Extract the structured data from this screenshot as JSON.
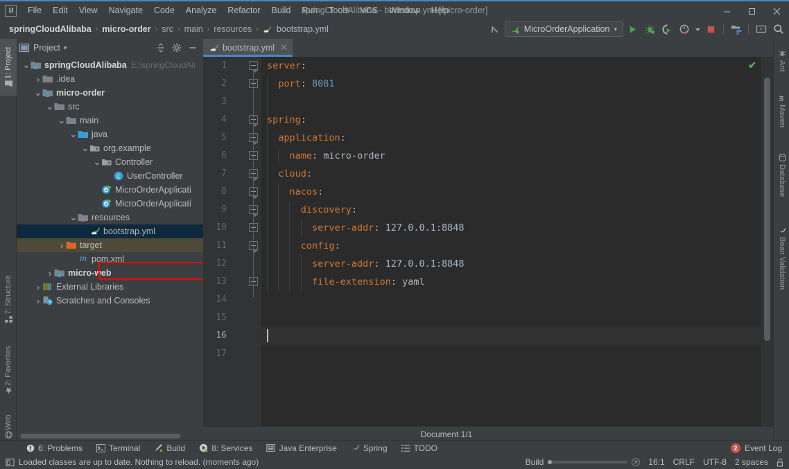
{
  "window": {
    "title": "springCloudAlibaba - bootstrap.yml [micro-order]",
    "minimize": "—",
    "maximize": "☐",
    "close": "✕"
  },
  "menu": {
    "items": [
      "File",
      "Edit",
      "View",
      "Navigate",
      "Code",
      "Analyze",
      "Refactor",
      "Build",
      "Run",
      "Tools",
      "VCS",
      "Window",
      "Help"
    ]
  },
  "breadcrumb": {
    "items": [
      {
        "label": "springCloudAlibaba",
        "style": "bold"
      },
      {
        "label": "micro-order",
        "style": "bold"
      },
      {
        "label": "src",
        "style": "dim"
      },
      {
        "label": "main",
        "style": "dim"
      },
      {
        "label": "resources",
        "style": "dim"
      },
      {
        "label": "bootstrap.yml",
        "style": "file"
      }
    ],
    "separator": "›"
  },
  "toolbar": {
    "run_config": "MicroOrderApplication",
    "dropdown_caret": "▾",
    "icons": [
      "back-arrow-icon",
      "run-icon",
      "debug-icon",
      "run-coverage-icon",
      "profiler-icon",
      "stop-icon",
      "project-structure-icon",
      "show-in-window-icon",
      "search-everywhere-icon"
    ]
  },
  "left_stripe": {
    "items": [
      {
        "label": "1: Project",
        "active": true
      },
      {
        "label": "7: Structure",
        "active": false
      },
      {
        "label": "2: Favorites",
        "active": false
      },
      {
        "label": "Web",
        "active": false
      }
    ]
  },
  "right_stripe": {
    "items": [
      {
        "label": "Ant"
      },
      {
        "label": "Maven"
      },
      {
        "label": "Database"
      },
      {
        "label": "Bean Validation"
      }
    ]
  },
  "project_panel": {
    "title": "Project",
    "caret": "▾",
    "header_icons": [
      "collapse-all-icon",
      "settings-gear-icon",
      "hide-icon"
    ],
    "tree": [
      {
        "indent": 0,
        "arrow": "⌄",
        "icon": "module-folder-icon",
        "label": "springCloudAlibaba",
        "bold": true,
        "path": "E:\\springCloudAli",
        "state": "normal"
      },
      {
        "indent": 1,
        "arrow": "›",
        "icon": "folder-icon",
        "label": ".idea",
        "bold": false,
        "path": "",
        "state": "normal"
      },
      {
        "indent": 1,
        "arrow": "⌄",
        "icon": "module-folder-icon",
        "label": "micro-order",
        "bold": true,
        "path": "",
        "state": "normal"
      },
      {
        "indent": 2,
        "arrow": "⌄",
        "icon": "folder-icon",
        "label": "src",
        "bold": false,
        "path": "",
        "state": "normal"
      },
      {
        "indent": 3,
        "arrow": "⌄",
        "icon": "folder-icon",
        "label": "main",
        "bold": false,
        "path": "",
        "state": "normal"
      },
      {
        "indent": 4,
        "arrow": "⌄",
        "icon": "source-folder-icon",
        "label": "java",
        "bold": false,
        "path": "",
        "state": "normal"
      },
      {
        "indent": 5,
        "arrow": "⌄",
        "icon": "package-icon",
        "label": "org.example",
        "bold": false,
        "path": "",
        "state": "normal"
      },
      {
        "indent": 6,
        "arrow": "⌄",
        "icon": "package-icon",
        "label": "Controller",
        "bold": false,
        "path": "",
        "state": "normal"
      },
      {
        "indent": 7,
        "arrow": "",
        "icon": "java-class-icon",
        "label": "UserController",
        "bold": false,
        "path": "",
        "state": "normal"
      },
      {
        "indent": 6,
        "arrow": "",
        "icon": "spring-class-icon",
        "label": "MicroOrderApplicati",
        "bold": false,
        "path": "",
        "state": "normal"
      },
      {
        "indent": 6,
        "arrow": "",
        "icon": "spring-class-icon",
        "label": "MicroOrderApplicati",
        "bold": false,
        "path": "",
        "state": "normal"
      },
      {
        "indent": 4,
        "arrow": "⌄",
        "icon": "resource-folder-icon",
        "label": "resources",
        "bold": false,
        "path": "",
        "state": "normal"
      },
      {
        "indent": 5,
        "arrow": "",
        "icon": "yaml-leaf-icon",
        "label": "bootstrap.yml",
        "bold": false,
        "path": "",
        "state": "selected"
      },
      {
        "indent": 3,
        "arrow": "›",
        "icon": "target-folder-icon",
        "label": "target",
        "bold": false,
        "path": "",
        "state": "target"
      },
      {
        "indent": 4,
        "arrow": "",
        "icon": "maven-icon",
        "label": "pom.xml",
        "bold": false,
        "path": "",
        "state": "normal"
      },
      {
        "indent": 2,
        "arrow": "›",
        "icon": "module-folder-icon",
        "label": "micro-web",
        "bold": true,
        "path": "",
        "state": "normal"
      },
      {
        "indent": 1,
        "arrow": "›",
        "icon": "libraries-icon",
        "label": "External Libraries",
        "bold": false,
        "path": "",
        "state": "normal"
      },
      {
        "indent": 1,
        "arrow": "›",
        "icon": "scratches-icon",
        "label": "Scratches and Consoles",
        "bold": false,
        "path": "",
        "state": "normal"
      }
    ]
  },
  "editor": {
    "tab": {
      "label": "bootstrap.yml",
      "icon": "yaml-leaf-icon",
      "close": "✕"
    },
    "inspection_status": "✔",
    "caret_line": 16,
    "lines": [
      {
        "n": 1,
        "indent": 0,
        "tokens": [
          {
            "t": "server",
            "c": "k"
          },
          {
            "t": ":",
            "c": "val"
          }
        ]
      },
      {
        "n": 2,
        "indent": 1,
        "tokens": [
          {
            "t": "port",
            "c": "k"
          },
          {
            "t": ": ",
            "c": "val"
          },
          {
            "t": "8081",
            "c": "num"
          }
        ]
      },
      {
        "n": 3,
        "indent": 0,
        "tokens": []
      },
      {
        "n": 4,
        "indent": 0,
        "tokens": [
          {
            "t": "spring",
            "c": "k"
          },
          {
            "t": ":",
            "c": "val"
          }
        ]
      },
      {
        "n": 5,
        "indent": 1,
        "tokens": [
          {
            "t": "application",
            "c": "k"
          },
          {
            "t": ":",
            "c": "val"
          }
        ]
      },
      {
        "n": 6,
        "indent": 2,
        "tokens": [
          {
            "t": "name",
            "c": "k"
          },
          {
            "t": ": ",
            "c": "val"
          },
          {
            "t": "micro-order",
            "c": "val"
          }
        ]
      },
      {
        "n": 7,
        "indent": 1,
        "tokens": [
          {
            "t": "cloud",
            "c": "k"
          },
          {
            "t": ":",
            "c": "val"
          }
        ]
      },
      {
        "n": 8,
        "indent": 2,
        "tokens": [
          {
            "t": "nacos",
            "c": "k"
          },
          {
            "t": ":",
            "c": "val"
          }
        ]
      },
      {
        "n": 9,
        "indent": 3,
        "tokens": [
          {
            "t": "discovery",
            "c": "k"
          },
          {
            "t": ":",
            "c": "val"
          }
        ]
      },
      {
        "n": 10,
        "indent": 4,
        "tokens": [
          {
            "t": "server-addr",
            "c": "k"
          },
          {
            "t": ": ",
            "c": "val"
          },
          {
            "t": "127.0.0.1:8848",
            "c": "val"
          }
        ]
      },
      {
        "n": 11,
        "indent": 3,
        "tokens": [
          {
            "t": "config",
            "c": "k"
          },
          {
            "t": ":",
            "c": "val"
          }
        ]
      },
      {
        "n": 12,
        "indent": 4,
        "tokens": [
          {
            "t": "server-addr",
            "c": "k"
          },
          {
            "t": ": ",
            "c": "val"
          },
          {
            "t": "127.0.0.1:8848",
            "c": "val"
          }
        ]
      },
      {
        "n": 13,
        "indent": 4,
        "tokens": [
          {
            "t": "file-extension",
            "c": "k"
          },
          {
            "t": ": ",
            "c": "val"
          },
          {
            "t": "yaml",
            "c": "val"
          }
        ]
      },
      {
        "n": 14,
        "indent": 0,
        "tokens": []
      },
      {
        "n": 15,
        "indent": 0,
        "tokens": []
      },
      {
        "n": 16,
        "indent": 0,
        "tokens": []
      },
      {
        "n": 17,
        "indent": 0,
        "tokens": []
      }
    ],
    "document_status": "Document 1/1"
  },
  "tool_window_bar": {
    "items": [
      {
        "label": "6: Problems",
        "icon": "problems-icon",
        "mnemonic": "6"
      },
      {
        "label": "Terminal",
        "icon": "terminal-icon",
        "mnemonic": ""
      },
      {
        "label": "Build",
        "icon": "build-hammer-icon",
        "mnemonic": ""
      },
      {
        "label": "8: Services",
        "icon": "services-icon",
        "mnemonic": "8"
      },
      {
        "label": "Java Enterprise",
        "icon": "java-enterprise-icon",
        "mnemonic": ""
      },
      {
        "label": "Spring",
        "icon": "spring-leaf-icon",
        "mnemonic": ""
      },
      {
        "label": "TODO",
        "icon": "todo-list-icon",
        "mnemonic": ""
      }
    ],
    "event_log": {
      "label": "Event Log",
      "badge": "2"
    }
  },
  "status_bar": {
    "message": "Loaded classes are up to date. Nothing to reload. (moments ago)",
    "build_label": "Build",
    "caret_position": "16:1",
    "line_separator": "CRLF",
    "encoding": "UTF-8",
    "indent": "2 spaces",
    "lock_icon": "unlocked-icon"
  },
  "colors": {
    "accent_blue": "#4a88c7",
    "panel_bg": "#3c3f41",
    "editor_bg": "#2b2b2b",
    "gutter_bg": "#313335",
    "selection_bg": "#0d293e",
    "highlight_red": "#fe0000",
    "keyword_orange": "#cc7832",
    "number_blue": "#6897bb",
    "text_gray": "#a9b7c6"
  }
}
